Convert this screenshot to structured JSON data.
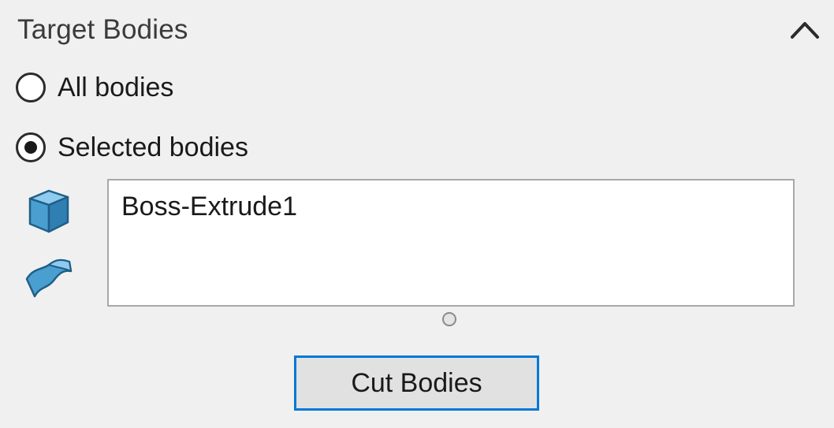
{
  "section": {
    "title": "Target Bodies",
    "collapse_icon": "chevron-up-icon"
  },
  "options": [
    {
      "label": "All bodies",
      "selected": false
    },
    {
      "label": "Selected bodies",
      "selected": true
    }
  ],
  "selection_list": {
    "filter_icons": [
      "solid-body-icon",
      "surface-body-icon"
    ],
    "items": [
      "Boss-Extrude1"
    ]
  },
  "actions": {
    "cut_label": "Cut Bodies"
  },
  "colors": {
    "accent": "#0078d7",
    "icon_blue": "#4a9fd1"
  }
}
